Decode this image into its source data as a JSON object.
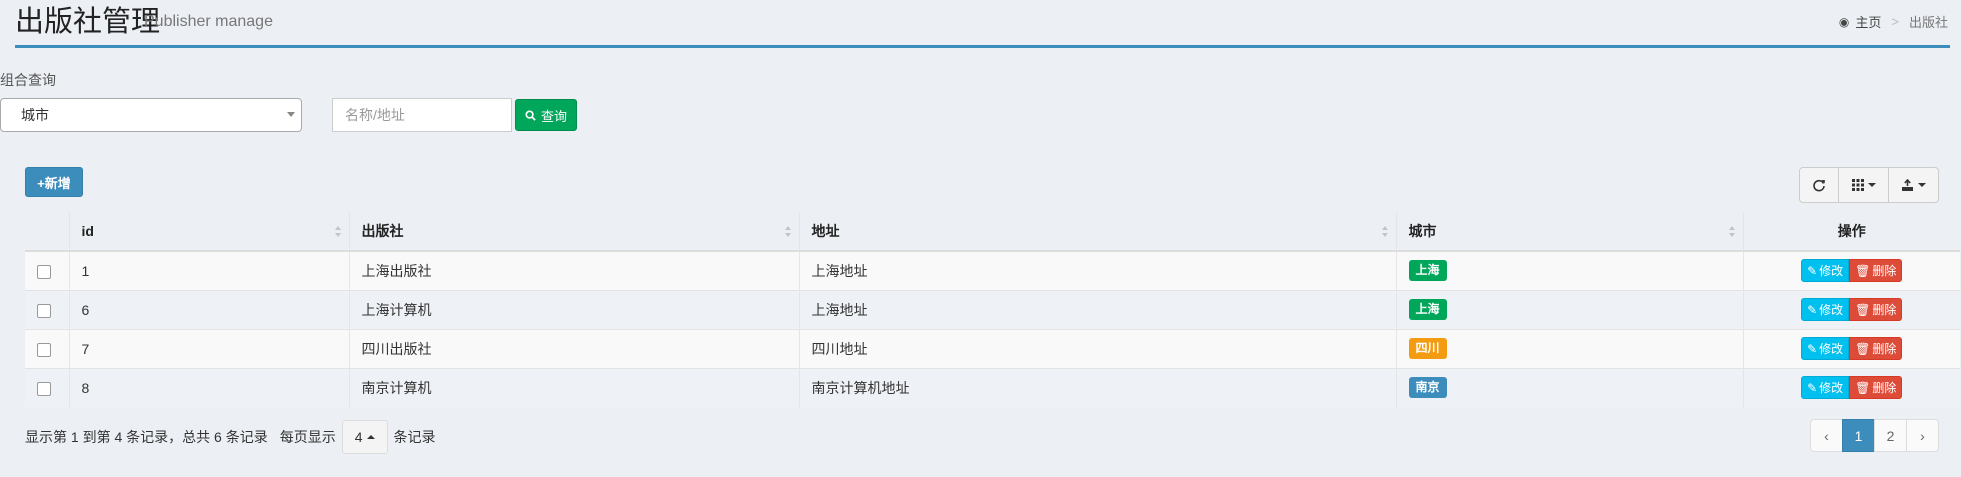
{
  "header": {
    "title": "出版社管理",
    "subtitle": "Publisher manage",
    "breadcrumb": {
      "home": "主页",
      "separator": ">",
      "current": "出版社"
    }
  },
  "filter": {
    "label": "组合查询",
    "city_select_value": "城市",
    "search_placeholder": "名称/地址",
    "query_button": "查询"
  },
  "toolbar": {
    "add_button": "+新增"
  },
  "table": {
    "columns": [
      "id",
      "出版社",
      "地址",
      "城市",
      "操作"
    ],
    "rows": [
      {
        "id": "1",
        "publisher": "上海出版社",
        "address": "上海地址",
        "city": "上海",
        "city_color": "#00a65a"
      },
      {
        "id": "6",
        "publisher": "上海计算机",
        "address": "上海地址",
        "city": "上海",
        "city_color": "#00a65a"
      },
      {
        "id": "7",
        "publisher": "四川出版社",
        "address": "四川地址",
        "city": "四川",
        "city_color": "#f39c12"
      },
      {
        "id": "8",
        "publisher": "南京计算机",
        "address": "南京计算机地址",
        "city": "南京",
        "city_color": "#3c8dbc"
      }
    ],
    "edit_label": "修改",
    "delete_label": "删除"
  },
  "footer": {
    "info": "显示第 1 到第 4 条记录，总共 6 条记录",
    "per_page_prefix": "每页显示",
    "per_page_value": "4",
    "per_page_suffix": "条记录",
    "pages": [
      "‹",
      "1",
      "2",
      "›"
    ],
    "active_page": "1"
  },
  "colors": {
    "accent": "#3c8dbc",
    "success": "#00a65a",
    "warning": "#f39c12",
    "info": "#00c0ef",
    "danger": "#dd4b39"
  }
}
